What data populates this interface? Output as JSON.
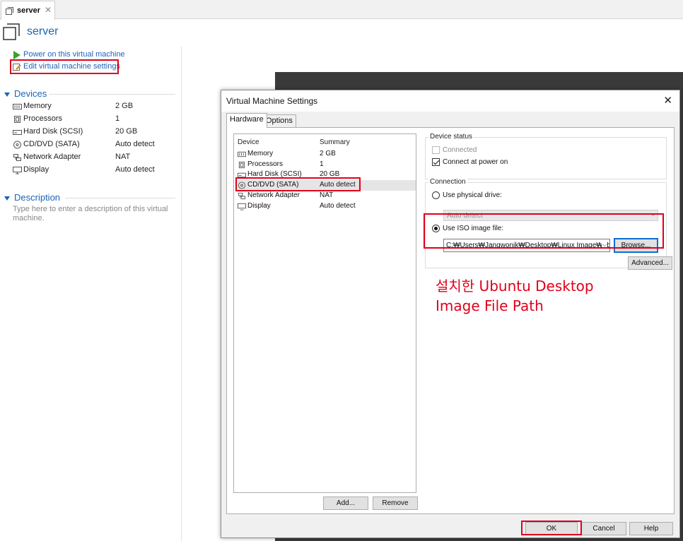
{
  "tab": {
    "label": "server",
    "close_glyph": "✕"
  },
  "header": {
    "title": "server"
  },
  "actions": {
    "power_on": "Power on this virtual machine",
    "edit_settings": "Edit virtual machine settings"
  },
  "devices": {
    "heading": "Devices",
    "items": [
      {
        "name": "Memory",
        "value": "2 GB",
        "icon": "memory-icon"
      },
      {
        "name": "Processors",
        "value": "1",
        "icon": "processor-icon"
      },
      {
        "name": "Hard Disk (SCSI)",
        "value": "20 GB",
        "icon": "hard-disk-icon"
      },
      {
        "name": "CD/DVD (SATA)",
        "value": "Auto detect",
        "icon": "cd-dvd-icon"
      },
      {
        "name": "Network Adapter",
        "value": "NAT",
        "icon": "network-adapter-icon"
      },
      {
        "name": "Display",
        "value": "Auto detect",
        "icon": "display-icon"
      }
    ]
  },
  "description": {
    "heading": "Description",
    "placeholder": "Type here to enter a description of this virtual machine."
  },
  "dialog": {
    "title": "Virtual Machine Settings",
    "close_glyph": "✕",
    "tabs": {
      "hardware": "Hardware",
      "options": "Options"
    },
    "device_list": {
      "col_device": "Device",
      "col_summary": "Summary",
      "rows": [
        {
          "name": "Memory",
          "summary": "2 GB"
        },
        {
          "name": "Processors",
          "summary": "1"
        },
        {
          "name": "Hard Disk (SCSI)",
          "summary": "20 GB"
        },
        {
          "name": "CD/DVD (SATA)",
          "summary": "Auto detect"
        },
        {
          "name": "Network Adapter",
          "summary": "NAT"
        },
        {
          "name": "Display",
          "summary": "Auto detect"
        }
      ],
      "selected_row": "CD/DVD (SATA)"
    },
    "add_label": "Add...",
    "remove_label": "Remove",
    "device_status": {
      "heading": "Device status",
      "connected": "Connected",
      "connect_at_power_on": "Connect at power on"
    },
    "connection": {
      "heading": "Connection",
      "use_physical": "Use physical drive:",
      "physical_value": "Auto detect",
      "use_iso": "Use ISO image file:",
      "iso_path": "C:₩Users₩Jangwonik₩Desktop₩Linux Image₩ub",
      "browse_label": "Browse...",
      "advanced_label": "Advanced..."
    },
    "ok_label": "OK",
    "cancel_label": "Cancel",
    "help_label": "Help"
  },
  "annotation": {
    "line1": "설치한 Ubuntu Desktop",
    "line2": "Image File Path"
  },
  "colors": {
    "accent_blue": "#1a64b4",
    "highlight_red": "#e0001a",
    "play_green": "#3aa12c"
  }
}
